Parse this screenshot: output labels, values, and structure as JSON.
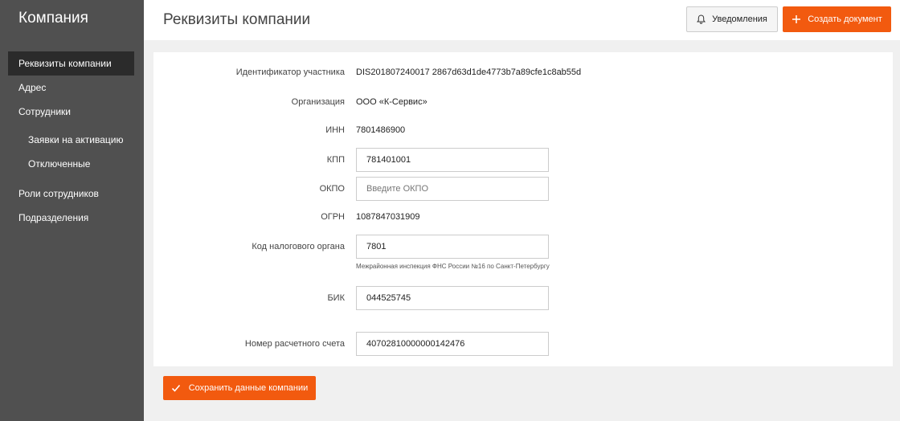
{
  "sidebar": {
    "title": "Компания",
    "items": [
      {
        "label": "Реквизиты компании"
      },
      {
        "label": "Адрес"
      },
      {
        "label": "Сотрудники"
      },
      {
        "label": "Заявки на активацию"
      },
      {
        "label": "Отключенные"
      },
      {
        "label": "Роли сотрудников"
      },
      {
        "label": "Подразделения"
      }
    ]
  },
  "header": {
    "title": "Реквизиты компании",
    "notifications_label": "Уведомления",
    "create_label": "Создать документ"
  },
  "form": {
    "participant_id": {
      "label": "Идентификатор участника",
      "value": "DIS201807240017 2867d63d1de4773b7a89cfe1c8ab55d"
    },
    "organization": {
      "label": "Организация",
      "value": "ООО «К-Сервис»"
    },
    "inn": {
      "label": "ИНН",
      "value": "7801486900"
    },
    "kpp": {
      "label": "КПП",
      "value": "781401001"
    },
    "okpo": {
      "label": "ОКПО",
      "value": "",
      "placeholder": "Введите ОКПО"
    },
    "ogrn": {
      "label": "ОГРН",
      "value": "1087847031909"
    },
    "tax_code": {
      "label": "Код налогового органа",
      "value": "7801",
      "hint": "Межрайонная инспекция ФНС России №16 по Санкт-Петербургу"
    },
    "bik": {
      "label": "БИК",
      "value": "044525745"
    },
    "account": {
      "label": "Номер расчетного счета",
      "value": "40702810000000142476"
    }
  },
  "footer": {
    "save_label": "Сохранить данные компании"
  },
  "colors": {
    "accent": "#f25a0f",
    "sidebar": "#505050",
    "sidebar_active": "#2b2b2b"
  }
}
